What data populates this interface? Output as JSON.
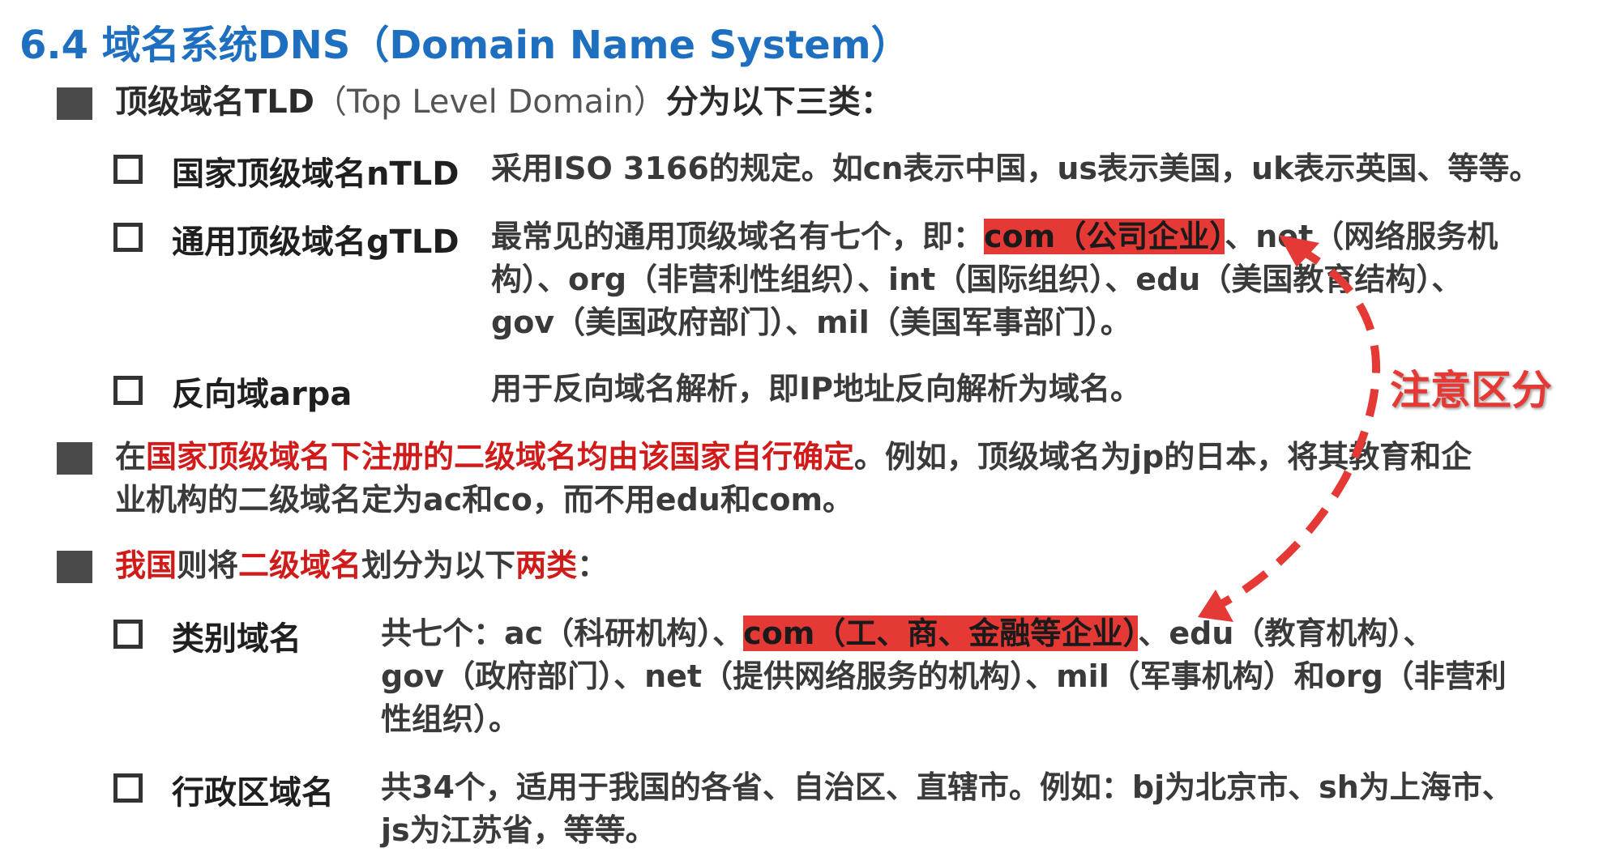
{
  "title": "6.4 域名系统DNS（Domain Name System）",
  "section1": {
    "pre": "顶级域名TLD",
    "light": "（Top Level Domain）",
    "post": "分为以下三类："
  },
  "items": {
    "ntld": {
      "label": "国家顶级域名nTLD",
      "desc": "采用ISO 3166的规定。如cn表示中国，us表示美国，uk表示英国、等等。"
    },
    "gtld": {
      "label": "通用顶级域名gTLD",
      "line1_pre": "最常见的通用顶级域名有七个，即：",
      "line1_hl": "com（公司企业）",
      "line1_post": "、net（网络服务机",
      "line2": "构）、org（非营利性组织）、int（国际组织）、edu（美国教育结构）、",
      "line3": "gov（美国政府部门）、mil（美国军事部门）。"
    },
    "arpa": {
      "label": "反向域arpa",
      "desc": "用于反向域名解析，即IP地址反向解析为域名。"
    }
  },
  "section2": {
    "pre": "在",
    "red": "国家顶级域名下注册的二级域名均由该国家自行确定",
    "post": "。例如，顶级域名为jp的日本，将其教育和企",
    "line2": "业机构的二级域名定为ac和co，而不用edu和com。"
  },
  "section3": {
    "red1": "我国",
    "mid1": "则将",
    "red2": "二级域名",
    "mid2": "划分为以下",
    "red3": "两类",
    "end": "："
  },
  "items2": {
    "category": {
      "label": "类别域名",
      "line1_pre": "共七个：ac（科研机构）、",
      "line1_hl": "com（工、商、金融等企业）",
      "line1_post": "、edu（教育机构）、",
      "line2": "gov（政府部门）、net（提供网络服务的机构）、mil（军事机构）和org（非营利",
      "line3": "性组织）。"
    },
    "admin": {
      "label": "行政区域名",
      "line1": "共34个，适用于我国的各省、自治区、直辖市。例如：bj为北京市、sh为上海市、",
      "line2": "js为江苏省，等等。"
    }
  },
  "note": "注意区分",
  "colors": {
    "title": "#1e6fc0",
    "red": "#d11a1a",
    "highlight": "#e53935",
    "bullet": "#4a4a4a"
  }
}
